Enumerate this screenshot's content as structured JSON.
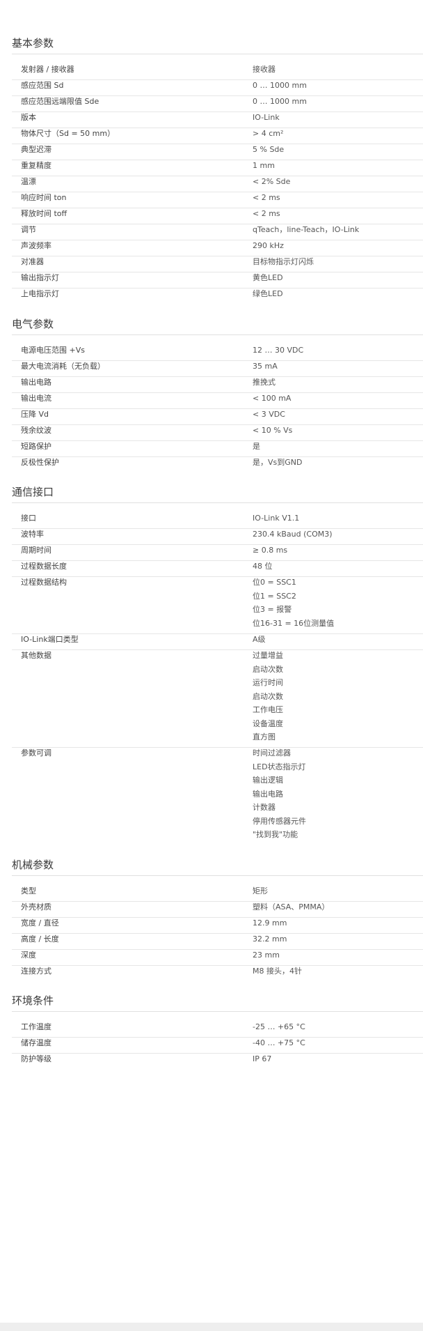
{
  "sections": [
    {
      "title": "基本参数",
      "rows": [
        {
          "label": "发射器 / 接收器",
          "values": [
            "接收器"
          ]
        },
        {
          "label": "感应范围 Sd",
          "values": [
            "0 … 1000 mm"
          ]
        },
        {
          "label": "感应范围远端限值 Sde",
          "values": [
            "0 … 1000 mm"
          ]
        },
        {
          "label": "版本",
          "values": [
            "IO-Link"
          ]
        },
        {
          "label": "物体尺寸（Sd = 50 mm）",
          "values": [
            "> 4 cm²"
          ]
        },
        {
          "label": "典型迟滞",
          "values": [
            "5 % Sde"
          ]
        },
        {
          "label": "重复精度",
          "values": [
            "1 mm"
          ]
        },
        {
          "label": "温漂",
          "values": [
            "< 2% Sde"
          ]
        },
        {
          "label": "响应时间 ton",
          "values": [
            "< 2 ms"
          ]
        },
        {
          "label": "释放时间 toff",
          "values": [
            "< 2 ms"
          ]
        },
        {
          "label": "调节",
          "values": [
            "qTeach，line-Teach，IO-Link"
          ]
        },
        {
          "label": "声波频率",
          "values": [
            "290 kHz"
          ]
        },
        {
          "label": "对准器",
          "values": [
            "目标物指示灯闪烁"
          ]
        },
        {
          "label": "输出指示灯",
          "values": [
            "黄色LED"
          ]
        },
        {
          "label": "上电指示灯",
          "values": [
            "绿色LED"
          ]
        }
      ]
    },
    {
      "title": "电气参数",
      "rows": [
        {
          "label": "电源电压范围 +Vs",
          "values": [
            "12 … 30 VDC"
          ]
        },
        {
          "label": "最大电流消耗（无负载）",
          "values": [
            "35 mA"
          ]
        },
        {
          "label": "输出电路",
          "values": [
            "推挽式"
          ]
        },
        {
          "label": "输出电流",
          "values": [
            "< 100 mA"
          ]
        },
        {
          "label": "压降 Vd",
          "values": [
            "< 3 VDC"
          ]
        },
        {
          "label": "残余纹波",
          "values": [
            "< 10 % Vs"
          ]
        },
        {
          "label": "短路保护",
          "values": [
            "是"
          ]
        },
        {
          "label": "反极性保护",
          "values": [
            "是，Vs到GND"
          ]
        }
      ]
    },
    {
      "title": "通信接口",
      "rows": [
        {
          "label": "接口",
          "values": [
            "IO-Link V1.1"
          ]
        },
        {
          "label": "波特率",
          "values": [
            "230.4 kBaud (COM3)"
          ]
        },
        {
          "label": "周期时间",
          "values": [
            "≥ 0.8 ms"
          ]
        },
        {
          "label": "过程数据长度",
          "values": [
            "48 位"
          ]
        },
        {
          "label": "过程数据结构",
          "values": [
            "位0 = SSC1",
            "位1 = SSC2",
            "位3 = 报警",
            "位16-31 = 16位测量值"
          ]
        },
        {
          "label": "IO-Link端口类型",
          "values": [
            "A级"
          ]
        },
        {
          "label": "其他数据",
          "values": [
            "过量增益",
            "启动次数",
            "运行时间",
            "启动次数",
            "工作电压",
            "设备温度",
            "直方图"
          ]
        },
        {
          "label": "参数可调",
          "values": [
            "时间过滤器",
            "LED状态指示灯",
            "输出逻辑",
            "输出电路",
            "计数器",
            "停用传感器元件",
            "\"找到我\"功能"
          ]
        }
      ]
    },
    {
      "title": "机械参数",
      "rows": [
        {
          "label": "类型",
          "values": [
            "矩形"
          ]
        },
        {
          "label": "外壳材质",
          "values": [
            "塑料（ASA、PMMA）"
          ]
        },
        {
          "label": "宽度 / 直径",
          "values": [
            "12.9 mm"
          ]
        },
        {
          "label": "高度 / 长度",
          "values": [
            "32.2 mm"
          ]
        },
        {
          "label": "深度",
          "values": [
            "23 mm"
          ]
        },
        {
          "label": "连接方式",
          "values": [
            "M8 接头，4针"
          ]
        }
      ]
    },
    {
      "title": "环境条件",
      "rows": [
        {
          "label": "工作温度",
          "values": [
            "-25 … +65 °C"
          ]
        },
        {
          "label": "储存温度",
          "values": [
            "-40 … +75 °C"
          ]
        },
        {
          "label": "防护等级",
          "values": [
            "IP 67"
          ]
        }
      ]
    }
  ]
}
